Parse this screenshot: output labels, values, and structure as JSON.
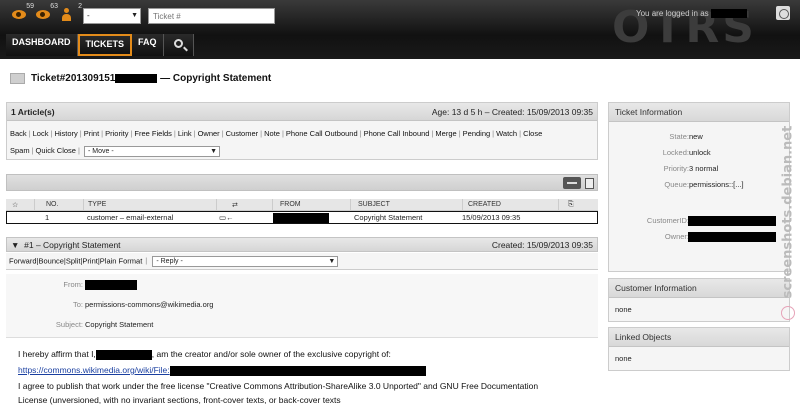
{
  "header": {
    "counters": [
      {
        "icon": "eye-icon",
        "count": "59"
      },
      {
        "icon": "eye-icon",
        "count": "63"
      },
      {
        "icon": "person-icon",
        "count": "2"
      }
    ],
    "queue_select": "-",
    "ticket_search_placeholder": "Ticket #",
    "logo": "OTRS",
    "logged_in_label": "You are logged in as"
  },
  "nav": [
    {
      "label": "DASHBOARD"
    },
    {
      "label": "TICKETS"
    },
    {
      "label": "FAQ"
    }
  ],
  "ticket": {
    "title_prefix": "Ticket#201309151",
    "title_suffix": "— Copyright Statement"
  },
  "articles": {
    "count_label": "1 Article(s)",
    "age_created": "Age: 13 d 5 h – Created: 15/09/2013 09:35",
    "actions_line1": [
      "Back",
      "Lock",
      "History",
      "Print",
      "Priority",
      "Free Fields",
      "Link",
      "Owner",
      "Customer",
      "Note",
      "Phone Call Outbound",
      "Phone Call Inbound",
      "Merge",
      "Pending",
      "Watch",
      "Close"
    ],
    "actions_line2": [
      "Spam",
      "Quick Close"
    ],
    "move_select": "- Move -"
  },
  "table": {
    "headers": {
      "no": "NO.",
      "type": "TYPE",
      "from": "FROM",
      "subject": "SUBJECT",
      "created": "CREATED"
    },
    "row": {
      "no": "1",
      "type": "customer – email-external",
      "subject": "Copyright Statement",
      "created": "15/09/2013 09:35"
    }
  },
  "article": {
    "heading": "#1 – Copyright Statement",
    "created": "Created: 15/09/2013 09:35",
    "actions": [
      "Forward",
      "Bounce",
      "Split",
      "Print",
      "Plain Format"
    ],
    "reply_select": "- Reply -",
    "from_label": "From:",
    "to_label": "To:",
    "to_value": "permissions-commons@wikimedia.org",
    "subject_label": "Subject:",
    "subject_value": "Copyright Statement",
    "body_line1_a": "I hereby affirm that I,",
    "body_line1_b": ", am the creator and/or sole owner of the exclusive copyright of:",
    "body_link": "https://commons.wikimedia.org/wiki/File:",
    "body_line3": "I agree to publish that work under the free license \"Creative Commons Attribution-ShareAlike 3.0 Unported\" and GNU Free Documentation",
    "body_line4": "License (unversioned, with no invariant sections, front-cover texts, or back-cover texts"
  },
  "sidebar": {
    "ticket_info_title": "Ticket Information",
    "state_label": "State:",
    "state_value": "new",
    "locked_label": "Locked:",
    "locked_value": "unlock",
    "priority_label": "Priority:",
    "priority_value": "3 normal",
    "queue_label": "Queue:",
    "queue_value": "permissions::[...]",
    "customer_id_label": "CustomerID:",
    "owner_label": "Owner:",
    "customer_info_title": "Customer Information",
    "customer_info_value": "none",
    "linked_title": "Linked Objects",
    "linked_value": "none"
  },
  "watermark": "screenshots.debian.net",
  "colors": {
    "accent": "#e38b1a",
    "header_bg": "#111111",
    "link": "#1a3fa0"
  }
}
